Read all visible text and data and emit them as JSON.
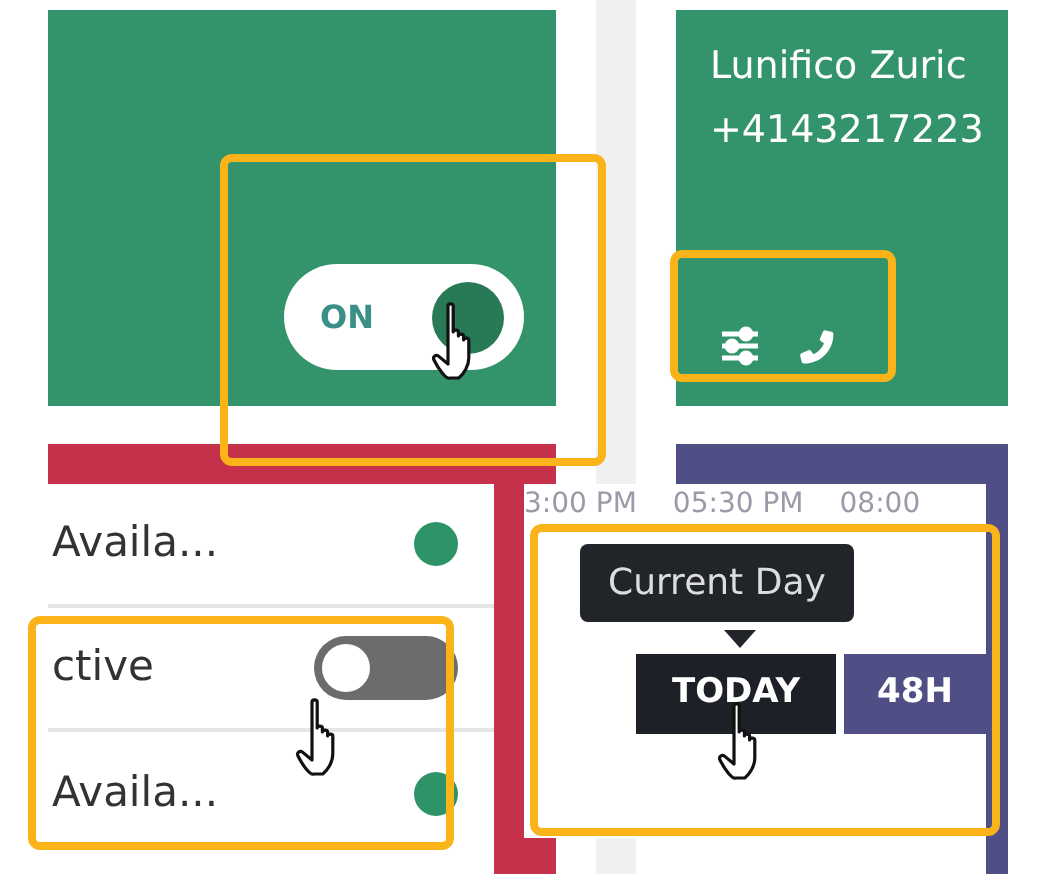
{
  "toggle_panel": {
    "toggle": {
      "label": "ON",
      "on": true
    }
  },
  "contact_panel": {
    "name": "Lunifico Zuric",
    "phone": "+4143217223"
  },
  "list": [
    {
      "kind": "status",
      "label": "Availa...",
      "color": "#2e9467"
    },
    {
      "kind": "toggle",
      "label": "ctive",
      "on": false
    },
    {
      "kind": "status",
      "label": "Availa...",
      "color": "#2e9467"
    }
  ],
  "timeline": {
    "times": [
      "3:00 PM",
      "05:30 PM",
      "08:00"
    ],
    "tooltip": "Current Day",
    "buttons": [
      {
        "label": "TODAY",
        "selected": true
      },
      {
        "label": "48H",
        "selected": false
      }
    ]
  }
}
